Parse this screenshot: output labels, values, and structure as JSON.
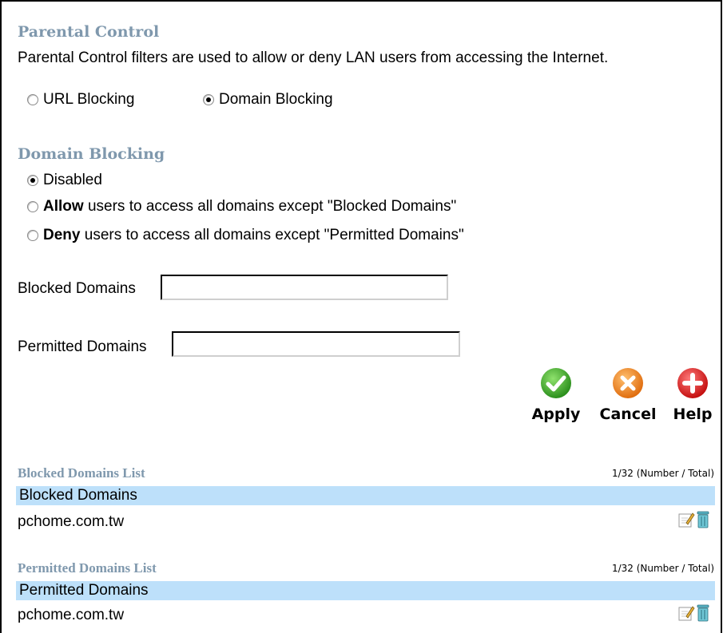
{
  "parental_control": {
    "title": "Parental Control",
    "description": "Parental Control filters are used to allow or deny LAN users from accessing the Internet.",
    "mode_options": [
      {
        "label": "URL Blocking",
        "checked": false
      },
      {
        "label": "Domain Blocking",
        "checked": true
      }
    ]
  },
  "domain_blocking": {
    "title": "Domain Blocking",
    "options": [
      {
        "bold": "",
        "label": "Disabled",
        "checked": true
      },
      {
        "bold": "Allow",
        "label": " users to access all domains except \"Blocked Domains\"",
        "checked": false
      },
      {
        "bold": "Deny",
        "label": " users to access all domains except \"Permitted Domains\"",
        "checked": false
      }
    ],
    "blocked_label": "Blocked Domains",
    "blocked_value": "",
    "permitted_label": "Permitted Domains",
    "permitted_value": ""
  },
  "buttons": {
    "apply": "Apply",
    "cancel": "Cancel",
    "help": "Help"
  },
  "blocked_list": {
    "title": "Blocked Domains List",
    "count": "1/32 (Number / Total)",
    "header": "Blocked Domains",
    "rows": [
      "pchome.com.tw"
    ]
  },
  "permitted_list": {
    "title": "Permitted Domains List",
    "count": "1/32 (Number / Total)",
    "header": "Permitted Domains",
    "rows": [
      "pchome.com.tw"
    ]
  },
  "colors": {
    "title_blue": "#7f98ad",
    "header_blue": "#bde0fa",
    "apply_green": "#3fae2a",
    "cancel_orange": "#f08a1d",
    "help_red": "#d81e1e"
  },
  "icons": [
    "check-icon",
    "x-icon",
    "plus-icon",
    "edit-icon",
    "trash-icon"
  ]
}
